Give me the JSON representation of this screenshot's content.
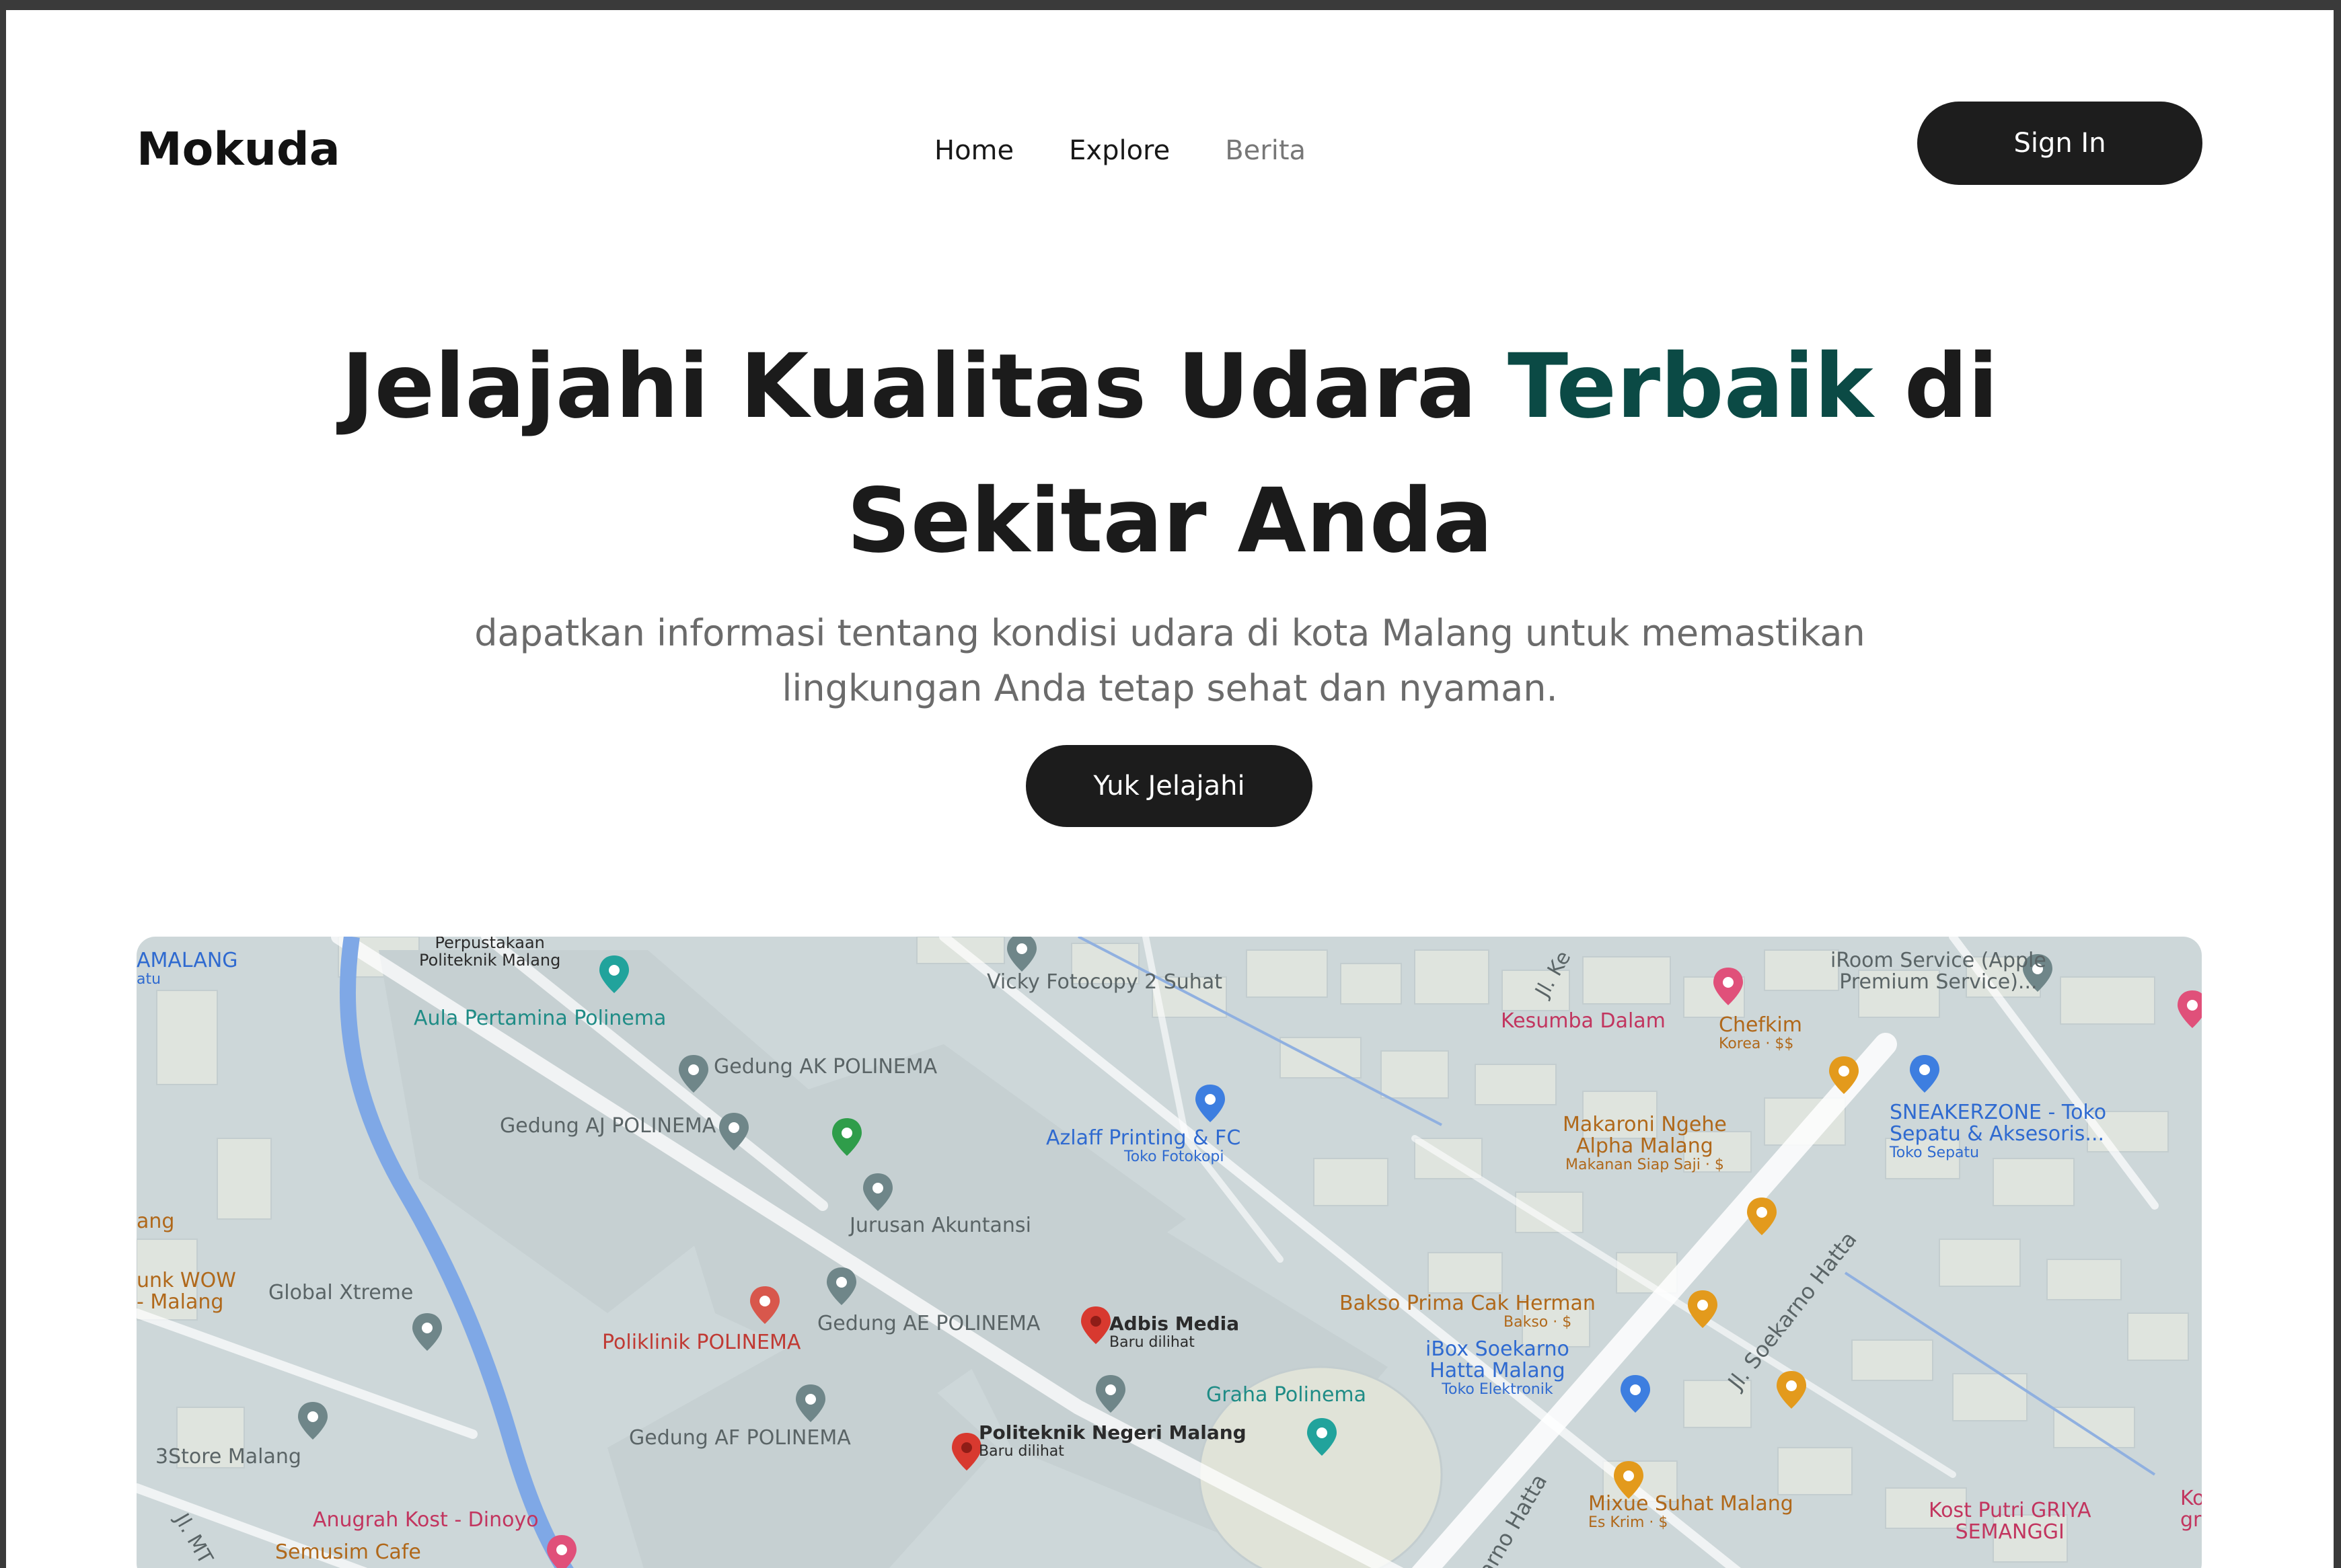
{
  "header": {
    "logo": "Mokuda",
    "nav": [
      "Home",
      "Explore",
      "Berita"
    ],
    "signin_label": "Sign In"
  },
  "hero": {
    "title_part1": "Jelajahi Kualitas Udara ",
    "title_accent": "Terbaik",
    "title_part2": " di",
    "title_line2": "Sekitar Anda",
    "subtitle_line1": "dapatkan informasi tentang kondisi udara di kota Malang untuk memastikan",
    "subtitle_line2": "lingkungan Anda tetap sehat dan nyaman.",
    "cta_label": "Yuk Jelajahi",
    "accent_color": "#0b4a45"
  },
  "map": {
    "places": {
      "perpustakaan": "Perpustakaan",
      "perpustakaan2": "Politeknik Malang",
      "amalang": "AMALANG",
      "atu": "atu",
      "aula": "Aula Pertamina Polinema",
      "vicky": "Vicky Fotocopy 2 Suhat",
      "jl_ke": "Jl. Ke",
      "kesumba": "Kesumba Dalam",
      "iroom1": "iRoom Service (Apple",
      "iroom2": "Premium Service)...",
      "chefkim": "Chefkim",
      "chefkim_sub": "Korea · $$",
      "gedung_ak": "Gedung AK POLINEMA",
      "gedung_aj": "Gedung AJ POLINEMA",
      "azlaff": "Azlaff Printing & FC",
      "azlaff_sub": "Toko Fotokopi",
      "makaroni1": "Makaroni Ngehe",
      "makaroni2": "Alpha Malang",
      "makaroni_sub": "Makanan Siap Saji · $",
      "sneaker1": "SNEAKERZONE - Toko",
      "sneaker2": "Sepatu & Aksesoris...",
      "sneaker_sub": "Toko Sepatu",
      "jurusan": "Jurusan Akuntansi",
      "ang": "ang",
      "soekarno": "Jl. Soekarno Hatta",
      "unk_wow": "unk WOW",
      "malang_frag": "- Malang",
      "global": "Global Xtreme",
      "poliklinik": "Poliklinik POLINEMA",
      "gedung_ae": "Gedung AE POLINEMA",
      "adbis": "Adbis Media",
      "adbis_sub": "Baru dilihat",
      "bakso": "Bakso Prima Cak Herman",
      "bakso_sub": "Bakso · $",
      "ibox1": "iBox Soekarno",
      "ibox2": "Hatta Malang",
      "ibox_sub": "Toko Elektronik",
      "graha": "Graha Polinema",
      "store3": "3Store Malang",
      "gedung_af": "Gedung AF POLINEMA",
      "politeknik": "Politeknik Negeri Malang",
      "politeknik_sub": "Baru dilihat",
      "anugrah": "Anugrah Kost - Dinoyo",
      "semusim": "Semusim Cafe",
      "jl_mt": "Jl. MT",
      "soekarno2": "arno Hatta",
      "mixue": "Mixue Suhat Malang",
      "mixue_sub": "Es Krim · $",
      "kost1": "Kost Putri GRIYA",
      "kost2": "SEMANGGI",
      "ko": "Ko",
      "gr": "gr"
    }
  }
}
